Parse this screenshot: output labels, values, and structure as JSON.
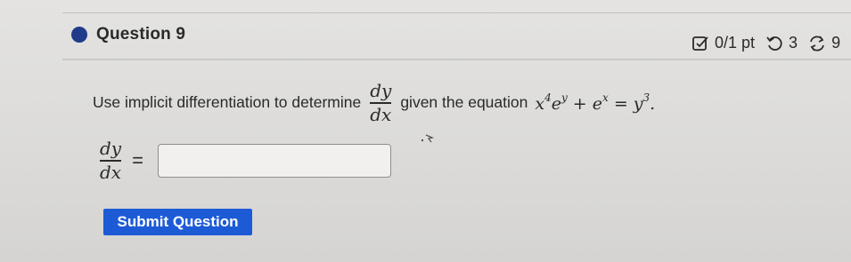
{
  "question": {
    "title": "Question 9",
    "score": "0/1 pt",
    "attempts": "3",
    "retries": "9",
    "prompt_before": "Use implicit differentiation to determine",
    "derivative": {
      "numerator": "dy",
      "denominator": "dx"
    },
    "prompt_middle": "given the equation",
    "equation": {
      "part1": "x",
      "exp1": "4",
      "part2": "e",
      "exp2": "y",
      "part3": " + e",
      "exp3": "x",
      "part4": " = y",
      "exp4": "3",
      "end": "."
    }
  },
  "answer": {
    "label_numerator": "dy",
    "label_denominator": "dx",
    "equals": "=",
    "value": "",
    "placeholder": ""
  },
  "submit": {
    "label": "Submit Question"
  },
  "colors": {
    "accent": "#1d5bd6",
    "status_dot": "#1f3b8a",
    "background": "#dcdbd9"
  },
  "icons": [
    "status-dot-icon",
    "score-check-icon",
    "retry-icon",
    "sync-icon",
    "mouse-cursor-icon"
  ]
}
